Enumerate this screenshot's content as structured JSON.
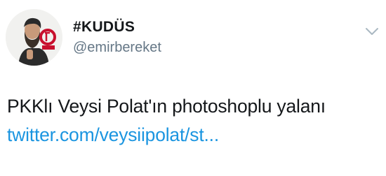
{
  "tweet": {
    "author": {
      "display_name": "#KUDÜS",
      "handle": "@emirbereket",
      "avatar_icon": "profile-avatar"
    },
    "menu_icon": "chevron-down-icon",
    "text": "PKKlı Veysi Polat'ın photoshoplu yalanı",
    "link_text": "twitter.com/veysiipolat/st...",
    "colors": {
      "name": "#14171a",
      "handle": "#657786",
      "body": "#14171a",
      "link": "#1b95e0",
      "caret": "#aab8c2",
      "avatar_badge": "#c8102e"
    }
  }
}
